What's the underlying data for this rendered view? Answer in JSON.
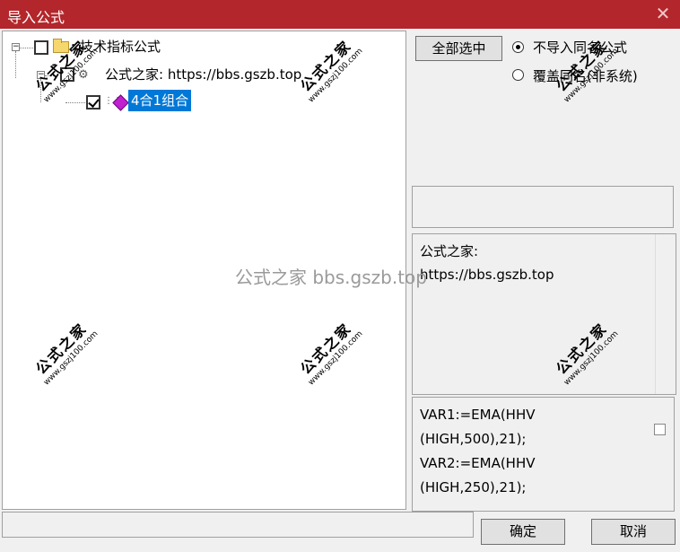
{
  "window": {
    "title": "导入公式",
    "close_glyph": "✕"
  },
  "tree": {
    "root": {
      "label": "技术指标公式",
      "expander": "−",
      "checked": false
    },
    "child": {
      "label": "公式之家: https://bbs.gszb.top",
      "expander": "−",
      "checked": false
    },
    "leaf": {
      "label": "4合1组合",
      "checked": true
    }
  },
  "options": {
    "select_all_label": "全部选中",
    "radio_no_import_label": "不导入同名公式",
    "radio_overwrite_label": "覆盖同名(非系统)",
    "selected_option": "no_import"
  },
  "info": {
    "line1": "公式之家:",
    "line2": "https://bbs.gszb.top"
  },
  "code": {
    "line1": "VAR1:=EMA(HHV",
    "line2": "(HIGH,500),21);",
    "line3": "VAR2:=EMA(HHV",
    "line4": "(HIGH,250),21);"
  },
  "footer": {
    "ok_label": "确定",
    "cancel_label": "取消"
  },
  "watermark": {
    "center_text": "公式之家 bbs.gszb.top",
    "stamp_title": "公式之家",
    "stamp_url": "www.gszj100.com"
  },
  "colors": {
    "titlebar": "#b3262b",
    "selection": "#0078d7"
  },
  "icons": {
    "folder": "folder-icon",
    "formula_group": "gear-icon",
    "formula": "gem-icon"
  }
}
